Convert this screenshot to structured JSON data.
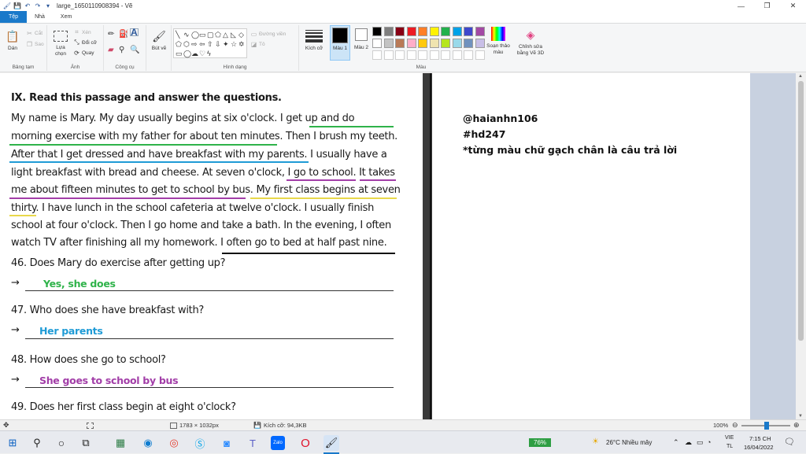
{
  "window": {
    "title": "large_1650110908394 - Vẽ"
  },
  "tabs": [
    {
      "label": "Tệp"
    },
    {
      "label": "Nhà"
    },
    {
      "label": "Xem"
    }
  ],
  "ribbon": {
    "clipboard": {
      "paste": "Dán",
      "cut": "Cắt",
      "copy": "Sao",
      "group": "Bảng tạm"
    },
    "image": {
      "select": "Lựa chọn",
      "crop": "Xén",
      "resize": "Đổi cỡ",
      "rotate": "Quay",
      "group": "Ảnh"
    },
    "tools": {
      "group": "Công cụ"
    },
    "brushes": {
      "label": "Bút vẽ"
    },
    "shapes": {
      "outline": "Đường viền",
      "fill": "Tô",
      "group": "Hình dạng"
    },
    "size": {
      "label": "Kích cỡ"
    },
    "color1": {
      "label": "Màu 1"
    },
    "color2": {
      "label": "Màu 2"
    },
    "colors": {
      "group": "Màu",
      "edit": "Soạn thảo màu",
      "edit3d": "Chỉnh sửa bằng Vẽ 3D"
    }
  },
  "passage": {
    "heading": "IX. Read this passage and answer the questions.",
    "lines": [
      "My name is Mary. My day usually begins at six o'clock. I get up and do",
      "morning exercise with my father for about ten minutes. Then I brush my teeth.",
      "After that I get dressed and have breakfast with my parents. I usually have a",
      "light breakfast with bread and cheese. At seven o'clock, I go to school. It takes",
      "me about fifteen minutes to get to school by bus.  My first class begins at seven",
      "thirty. I have lunch in the school cafeteria at twelve o'clock. I usually finish",
      "school at four o'clock. Then I go home and take a bath. In the evening, I often",
      "watch TV after finishing all my homework. I often go to bed at half past nine."
    ],
    "questions": [
      {
        "q": "46. Does Mary do exercise after getting up?",
        "a": "Yes, she does",
        "color": "#2fb34a"
      },
      {
        "q": "47. Who does she have breakfast with?",
        "a": "Her parents",
        "color": "#1f9bd6"
      },
      {
        "q": "48. How does she go to school?",
        "a": "She goes to school by bus",
        "color": "#a23ea8"
      },
      {
        "q": "49. Does her first class begin at eight o'clock?",
        "a": "",
        "color": "#000000"
      }
    ],
    "arrow": "→"
  },
  "notes": {
    "line1": "@haianhn106",
    "line2": "#hd247",
    "line3": "*từng màu chữ gạch chân là câu trả lời"
  },
  "status": {
    "dimensions": "1783 × 1032px",
    "filesize": "Kích cỡ: 94,3KB",
    "zoom": "100%"
  },
  "taskbar": {
    "battery": "76%",
    "weather": "26°C  Nhiều mây",
    "lang1": "VIE",
    "lang2": "TL",
    "time": "7:15 CH",
    "date": "16/04/2022",
    "zalo": "Zalo"
  },
  "palette": [
    "#000000",
    "#7f7f7f",
    "#880015",
    "#ed1c24",
    "#ff7f27",
    "#fff200",
    "#22b14c",
    "#00a2e8",
    "#3f48cc",
    "#a349a4",
    "#ffffff",
    "#c3c3c3",
    "#b97a57",
    "#ffaec9",
    "#ffc90e",
    "#efe4b0",
    "#b5e61d",
    "#99d9ea",
    "#7092be",
    "#c8bfe7"
  ],
  "accent": "#1979ca"
}
